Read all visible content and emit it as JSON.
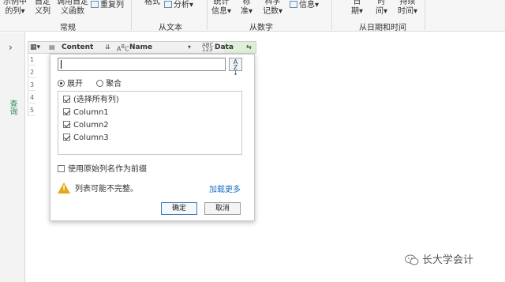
{
  "ribbon": {
    "general_group": {
      "label": "常规",
      "btn_example_column": [
        "示例中",
        "的列"
      ],
      "btn_custom_column": [
        "自定",
        "义列"
      ],
      "btn_invoke_custom_function": [
        "调用自定",
        "义函数"
      ],
      "btn_duplicate_column": "重复列"
    },
    "text_group": {
      "label": "从文本",
      "btn_format": "格式",
      "btn_parse": "分析"
    },
    "number_group": {
      "label": "从数字",
      "btn_statistics": [
        "统计",
        "信息"
      ],
      "btn_standard": [
        "标",
        "准"
      ],
      "btn_scientific": [
        "科学",
        "记数"
      ],
      "btn_info": "信息"
    },
    "datetime_group": {
      "label": "从日期和时间",
      "btn_date": [
        "日",
        "期"
      ],
      "btn_time": [
        "时",
        "间"
      ],
      "btn_duration": [
        "持续",
        "时间"
      ]
    }
  },
  "left_rail": {
    "label": "查询"
  },
  "grid": {
    "columns": [
      {
        "name": "Content",
        "type_icon": "binary-icon"
      },
      {
        "name": "Name",
        "type_icon": "text-type-icon"
      },
      {
        "name": "Data",
        "type_icon": "any-type-icon"
      }
    ]
  },
  "dialog": {
    "search_value": "",
    "mode_expand": "展开",
    "mode_aggregate": "聚合",
    "selected_mode": "expand",
    "items": [
      {
        "label": "(选择所有列)",
        "checked": true
      },
      {
        "label": "Column1",
        "checked": true
      },
      {
        "label": "Column2",
        "checked": true
      },
      {
        "label": "Column3",
        "checked": true
      }
    ],
    "prefix_label": "使用原始列名作为前缀",
    "prefix_checked": false,
    "warning_text": "列表可能不完整。",
    "load_more": "加载更多",
    "ok_label": "确定",
    "cancel_label": "取消"
  },
  "watermark": {
    "text": "长大学会计"
  },
  "colors": {
    "accent": "#2e8b57",
    "link": "#1a6fc4",
    "warning": "#e6a817"
  }
}
